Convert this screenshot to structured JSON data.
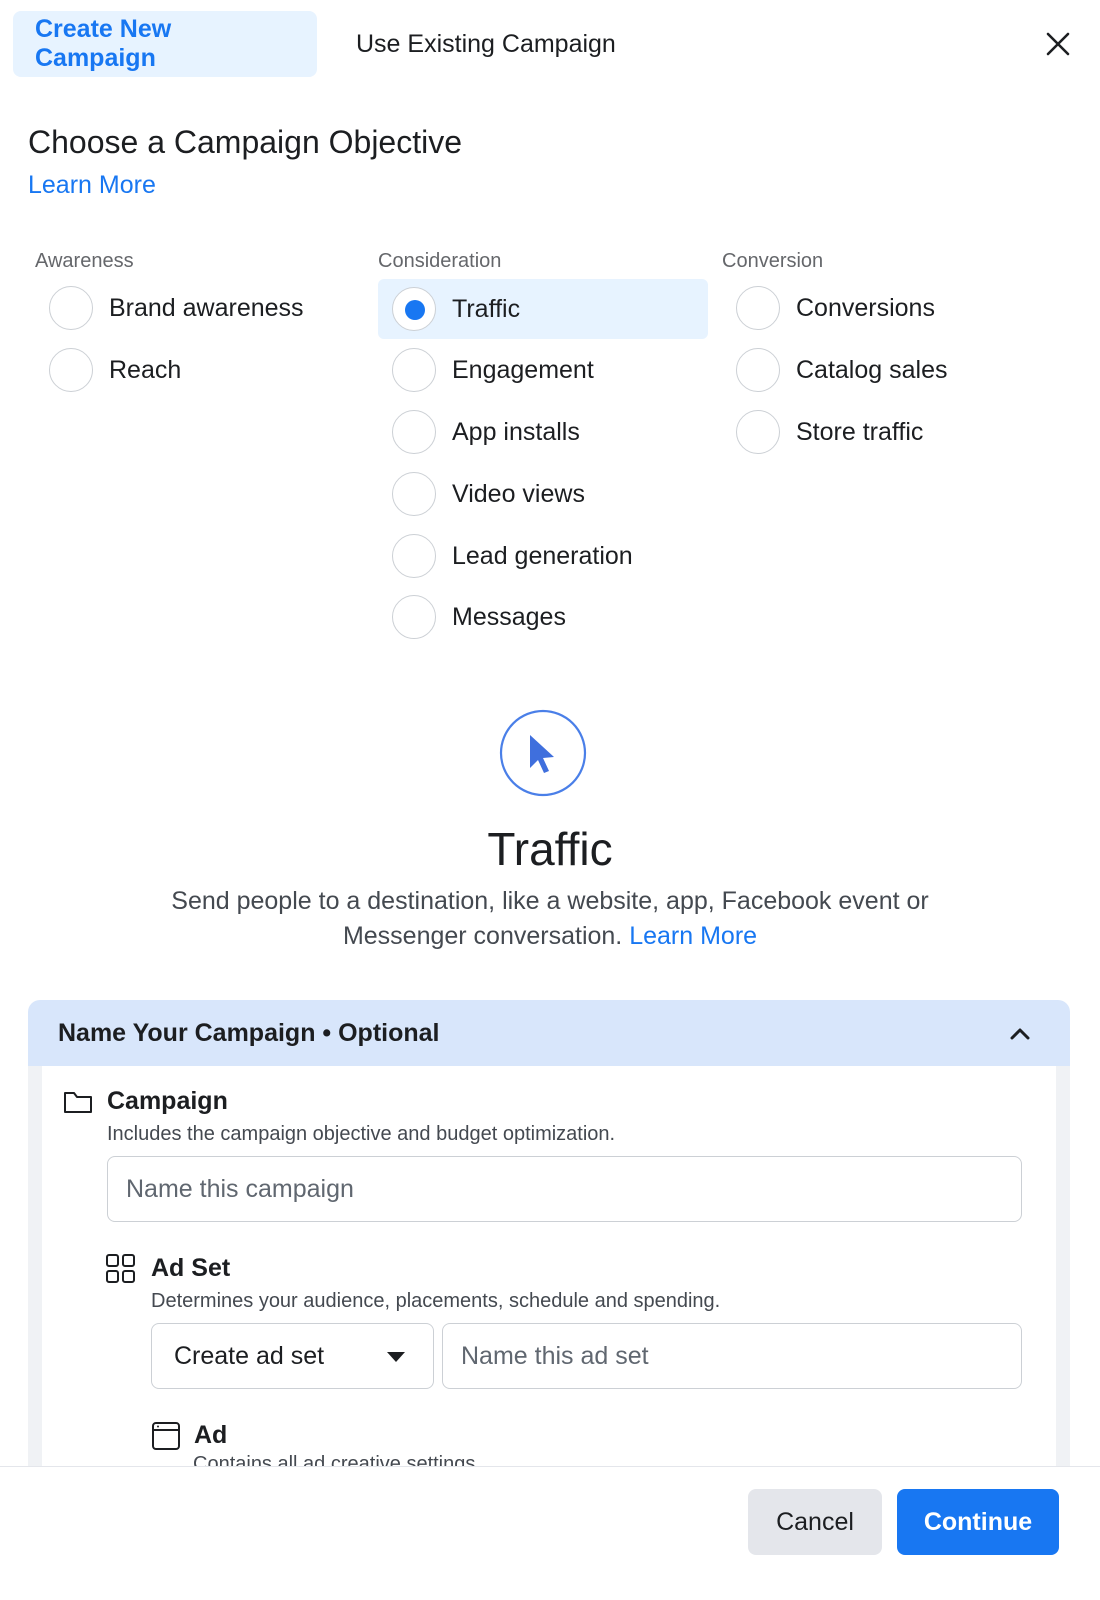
{
  "tabs": {
    "create": "Create New Campaign",
    "existing": "Use Existing Campaign"
  },
  "heading": {
    "title": "Choose a Campaign Objective",
    "learn_more": "Learn More"
  },
  "columns": {
    "awareness": {
      "label": "Awareness",
      "options": [
        "Brand awareness",
        "Reach"
      ]
    },
    "consideration": {
      "label": "Consideration",
      "options": [
        "Traffic",
        "Engagement",
        "App installs",
        "Video views",
        "Lead generation",
        "Messages"
      ]
    },
    "conversion": {
      "label": "Conversion",
      "options": [
        "Conversions",
        "Catalog sales",
        "Store traffic"
      ]
    }
  },
  "selected_option": "Traffic",
  "objective": {
    "icon": "cursor-icon",
    "title": "Traffic",
    "description": "Send people to a destination, like a website, app, Facebook event or Messenger conversation.",
    "learn_more": "Learn More"
  },
  "name_campaign": {
    "header": "Name Your Campaign • Optional",
    "campaign": {
      "title": "Campaign",
      "description": "Includes the campaign objective and budget optimization.",
      "placeholder": "Name this campaign"
    },
    "ad_set": {
      "title": "Ad Set",
      "description": "Determines your audience, placements, schedule and spending.",
      "select_value": "Create ad set",
      "placeholder": "Name this ad set"
    },
    "ad": {
      "title": "Ad",
      "description": "Contains all ad creative settings."
    }
  },
  "footer": {
    "cancel": "Cancel",
    "continue": "Continue"
  },
  "colors": {
    "accent": "#1877f2",
    "tab_active_bg": "#e7f3ff",
    "accordion_bg": "#d8e6fb"
  }
}
